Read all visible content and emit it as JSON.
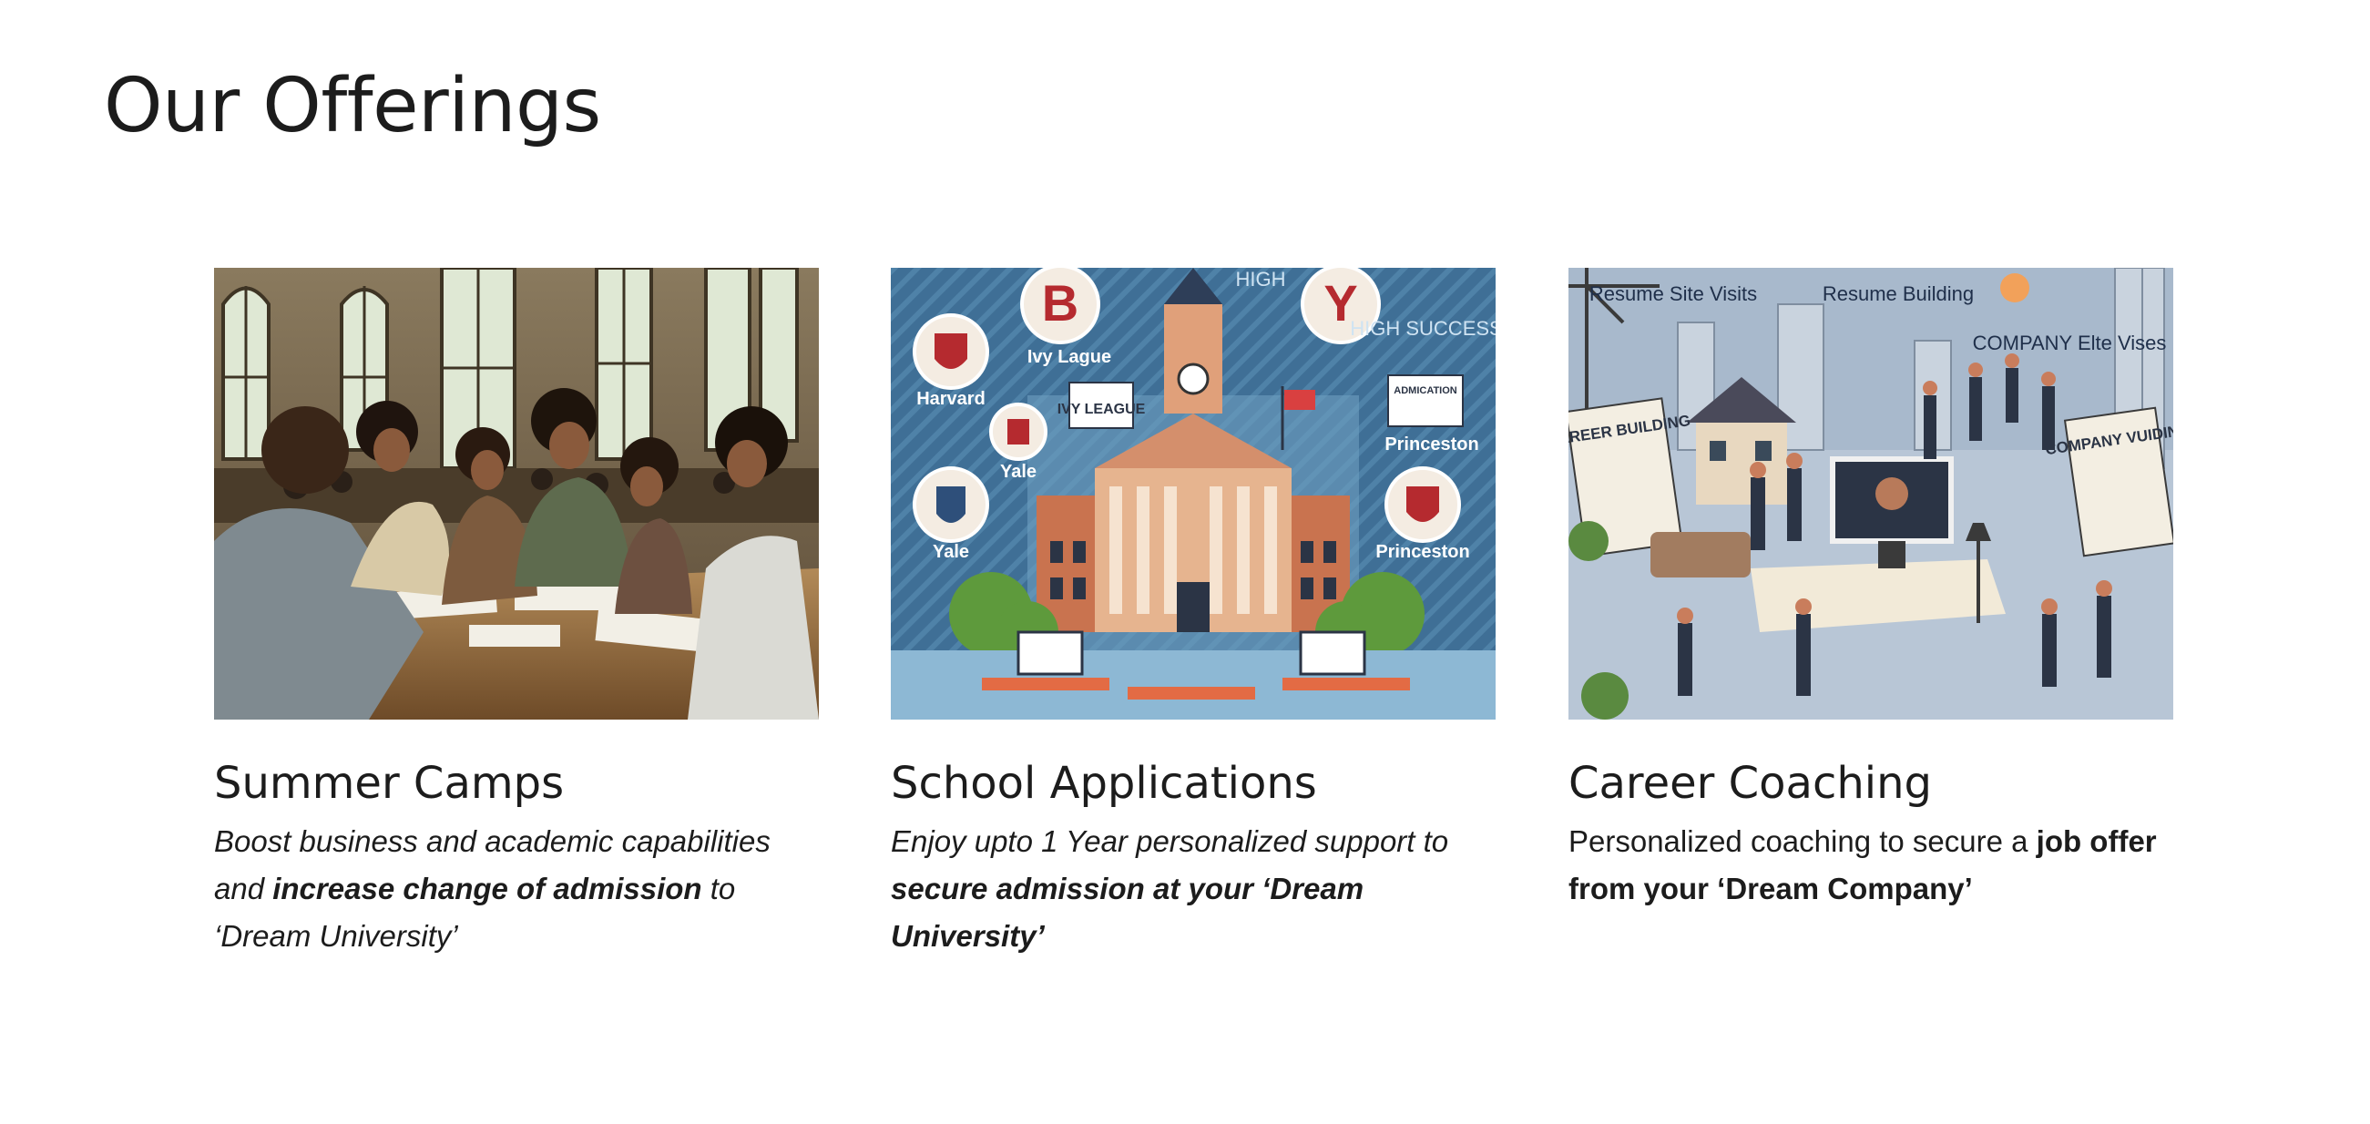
{
  "page": {
    "title": "Our Offerings"
  },
  "offerings": [
    {
      "title": "Summer Camps",
      "image_alt": "students studying together in a library",
      "description": {
        "part1": "Boost business and academic capabilities and ",
        "bold": "increase change of admission",
        "part2": " to ‘Dream University’"
      }
    },
    {
      "title": "School Applications",
      "image_alt": "illustrated campus with Ivy League university emblems",
      "description": {
        "part1": "Enjoy upto 1 Year personalized support to ",
        "bold": "secure admission at your ‘Dream University’",
        "part2": ""
      },
      "image_labels": [
        "HIGH",
        "HIGH SUCCESS",
        "Harvard",
        "Ivy Lague",
        "IVY LEAGUE",
        "Yale",
        "Yale",
        "Princeston",
        "Princeston",
        "ADMICATION",
        "B",
        "Y"
      ]
    },
    {
      "title": "Career Coaching",
      "description": {
        "part1": "Personalized coaching to secure a ",
        "bold": "job offer from your ‘Dream Company’",
        "part2": ""
      },
      "image_labels": [
        "Resume Site Visits",
        "Resume Building",
        "COMPANY Elte Vises",
        "CAREER BUILDING",
        "COMPANY VUIDING"
      ]
    }
  ]
}
